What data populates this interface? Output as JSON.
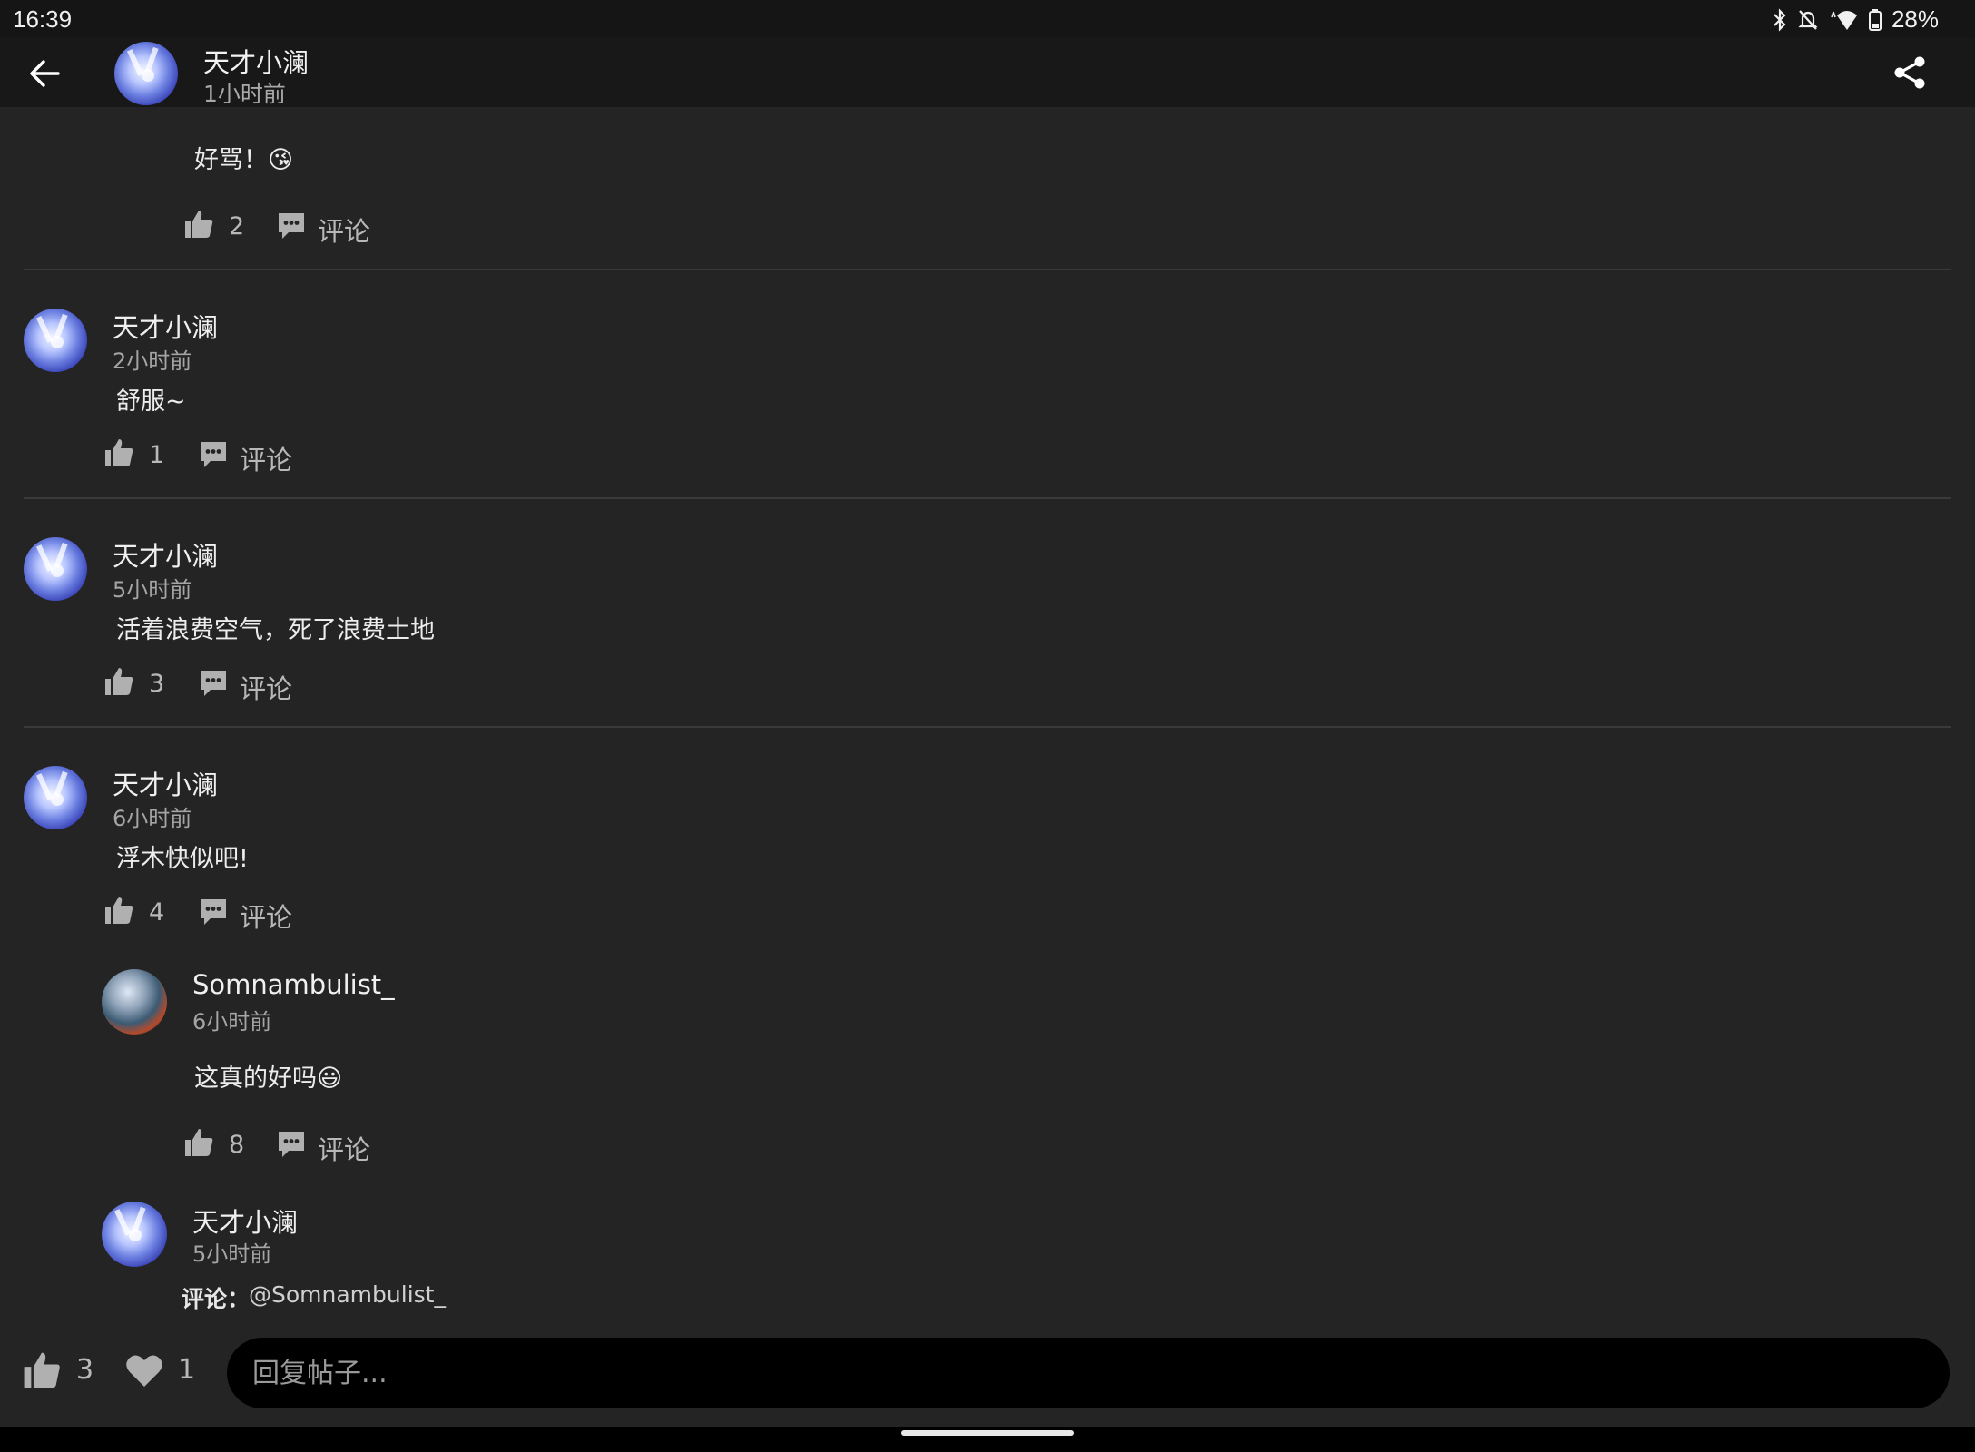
{
  "status_bar": {
    "time": "16:39",
    "battery": "28%",
    "icons": [
      "bluetooth-icon",
      "silent-icon",
      "wifi-icon",
      "battery-icon"
    ]
  },
  "header": {
    "author": "天才小澜",
    "time": "1小时前",
    "back_icon": "arrow-left-icon",
    "share_icon": "share-icon"
  },
  "comments": [
    {
      "body": "好骂！😘",
      "likes": "2",
      "comment_label": "评论"
    },
    {
      "author": "天才小澜",
      "time": "2小时前",
      "body": "舒服~",
      "likes": "1",
      "comment_label": "评论"
    },
    {
      "author": "天才小澜",
      "time": "5小时前",
      "body": "活着浪费空气，死了浪费土地",
      "likes": "3",
      "comment_label": "评论"
    },
    {
      "author": "天才小澜",
      "time": "6小时前",
      "body": "浮木快似吧!",
      "likes": "4",
      "comment_label": "评论",
      "replies": [
        {
          "author": "Somnambulist_",
          "time": "6小时前",
          "body": "这真的好吗😃",
          "likes": "8",
          "comment_label": "评论"
        },
        {
          "author": "天才小澜",
          "time": "5小时前",
          "prefix": "评论：",
          "mention": "@Somnambulist_"
        }
      ]
    }
  ],
  "bottom_bar": {
    "likes": "3",
    "hearts": "1",
    "reply_placeholder": "回复帖子..."
  },
  "colors": {
    "background": "#242424",
    "header": "#181818",
    "divider": "#3a3a3a",
    "icon": "#b0b0b0"
  }
}
